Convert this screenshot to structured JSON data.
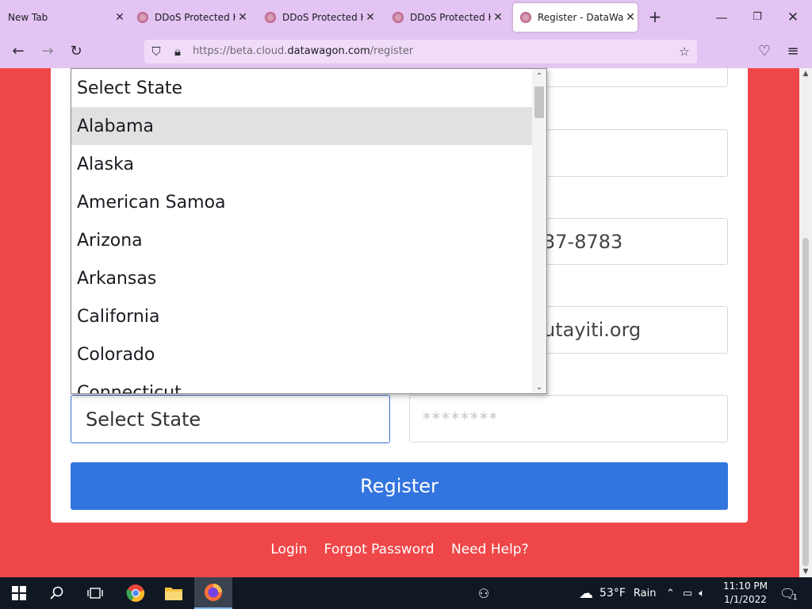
{
  "browser": {
    "tabs": [
      {
        "title": "New Tab",
        "active": false
      },
      {
        "title": "DDoS Protected Ho",
        "active": false
      },
      {
        "title": "DDoS Protected Ho",
        "active": false
      },
      {
        "title": "DDoS Protected Ho",
        "active": false
      },
      {
        "title": "Register - DataWag",
        "active": true
      }
    ],
    "url_dim_prefix": "https://beta.cloud.",
    "url_domain": "datawagon.com",
    "url_suffix": "/register"
  },
  "form": {
    "phone_partial": "37-8783",
    "email_partial": "utayiti.org",
    "state_select_value": "Select State",
    "password_placeholder": "********",
    "register_label": "Register"
  },
  "dropdown": {
    "options": [
      "Select State",
      "Alabama",
      "Alaska",
      "American Samoa",
      "Arizona",
      "Arkansas",
      "California",
      "Colorado",
      "Connecticut"
    ],
    "highlighted_index": 1
  },
  "footer_links": {
    "login": "Login",
    "forgot": "Forgot Password",
    "help": "Need Help?"
  },
  "taskbar": {
    "weather_temp": "53°F",
    "weather_desc": "Rain",
    "time": "11:10 PM",
    "date": "1/1/2022",
    "notification_count": "1"
  }
}
